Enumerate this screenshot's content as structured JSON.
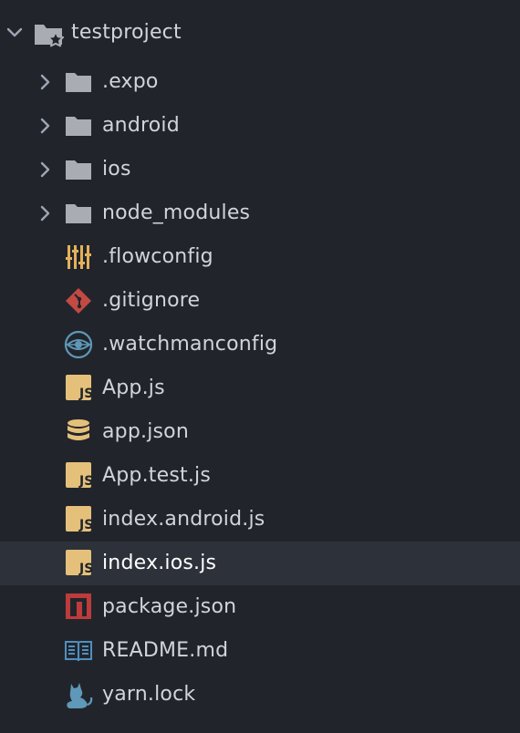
{
  "window": {
    "title": "testproject"
  },
  "colors": {
    "background": "#21252b",
    "selected_row": "#2c313a",
    "text": "#d1d4da",
    "folder": "#a9adb3",
    "js": "#e5c07b",
    "git": "#c24a43",
    "npm": "#bd3b3b",
    "watchman": "#5f98b8",
    "readme": "#4f8fbf",
    "yarn": "#5f98b8",
    "flowconfig": "#e5b15a"
  },
  "root": {
    "name": "testproject",
    "expanded": true,
    "icon": "repo-folder-icon"
  },
  "items": [
    {
      "name": ".expo",
      "kind": "folder",
      "expanded": false,
      "icon": "folder-icon"
    },
    {
      "name": "android",
      "kind": "folder",
      "expanded": false,
      "icon": "folder-icon"
    },
    {
      "name": "ios",
      "kind": "folder",
      "expanded": false,
      "icon": "folder-icon"
    },
    {
      "name": "node_modules",
      "kind": "folder",
      "expanded": false,
      "icon": "folder-icon"
    },
    {
      "name": ".flowconfig",
      "kind": "file",
      "icon": "config-sliders-icon"
    },
    {
      "name": ".gitignore",
      "kind": "file",
      "icon": "git-icon"
    },
    {
      "name": ".watchmanconfig",
      "kind": "file",
      "icon": "watchman-eye-icon"
    },
    {
      "name": "App.js",
      "kind": "file",
      "icon": "js-icon"
    },
    {
      "name": "app.json",
      "kind": "file",
      "icon": "database-icon"
    },
    {
      "name": "App.test.js",
      "kind": "file",
      "icon": "js-icon"
    },
    {
      "name": "index.android.js",
      "kind": "file",
      "icon": "js-icon"
    },
    {
      "name": "index.ios.js",
      "kind": "file",
      "icon": "js-icon",
      "selected": true
    },
    {
      "name": "package.json",
      "kind": "file",
      "icon": "npm-icon"
    },
    {
      "name": "README.md",
      "kind": "file",
      "icon": "readme-book-icon"
    },
    {
      "name": "yarn.lock",
      "kind": "file",
      "icon": "yarn-cat-icon"
    }
  ]
}
